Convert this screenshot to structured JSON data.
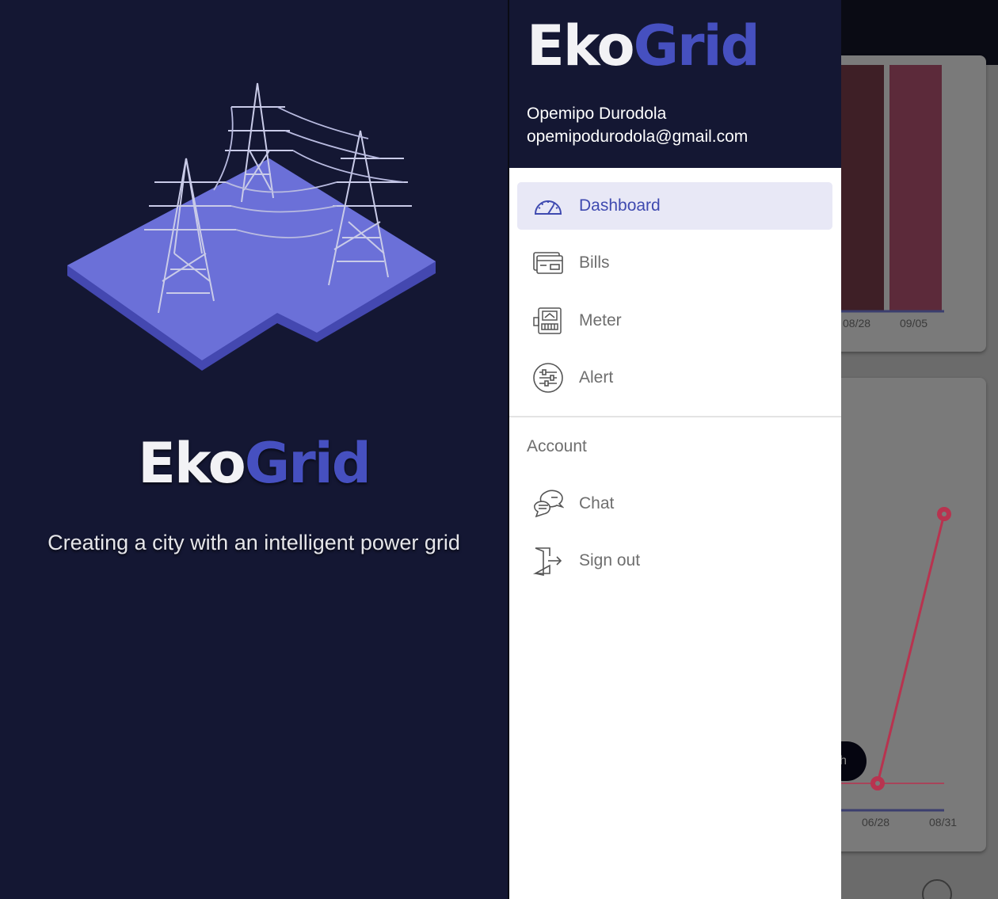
{
  "splash": {
    "logo_part1": "Eko",
    "logo_part2": "Grid",
    "tagline": "Creating a city with an intelligent power grid"
  },
  "drawer": {
    "logo_part1": "Eko",
    "logo_part2": "Grid",
    "user": {
      "name": "Opemipo Durodola",
      "email": "opemipodurodola@gmail.com"
    },
    "nav_items": [
      {
        "label": "Dashboard",
        "icon": "speedometer-icon",
        "active": true
      },
      {
        "label": "Bills",
        "icon": "bill-card-icon",
        "active": false
      },
      {
        "label": "Meter",
        "icon": "meter-icon",
        "active": false
      },
      {
        "label": "Alert",
        "icon": "alert-sliders-icon",
        "active": false
      }
    ],
    "account_heading": "Account",
    "account_items": [
      {
        "label": "Chat",
        "icon": "chat-icon"
      },
      {
        "label": "Sign out",
        "icon": "sign-out-icon"
      }
    ]
  },
  "background": {
    "bar_chart_ticks": [
      "08/28",
      "09/05"
    ],
    "line_chart_ticks": [
      "06/28",
      "08/31"
    ],
    "fab_label": "h"
  },
  "colors": {
    "brand_dark": "#141733",
    "brand_accent": "#4650c0",
    "active_item_bg": "#e8e8f6",
    "chart_bar": "#5c2a3a",
    "chart_line": "#b8334f"
  }
}
